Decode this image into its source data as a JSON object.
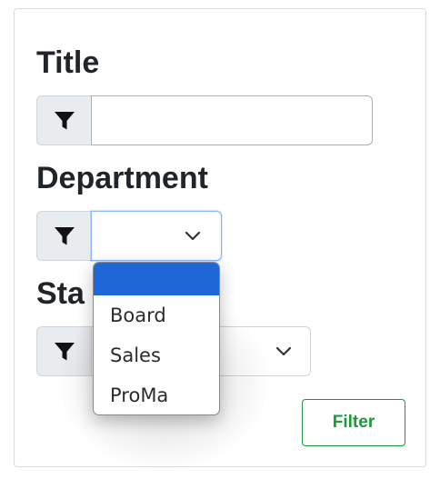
{
  "form": {
    "title_label": "Title",
    "title_value": "",
    "department_label": "Department",
    "department_value": "",
    "status_label_partial": "Sta",
    "status_value": ""
  },
  "dropdown": {
    "options": [
      "",
      "Board",
      "Sales",
      "ProMa"
    ],
    "selected_index": 0
  },
  "buttons": {
    "filter_label": "Filter"
  },
  "icons": {
    "filter": "filter-funnel-icon",
    "chevron": "chevron-down-icon"
  },
  "colors": {
    "filter_button": "#1a9a3a",
    "selected_option": "#1f66d6",
    "focus_border": "#86b7fe"
  }
}
